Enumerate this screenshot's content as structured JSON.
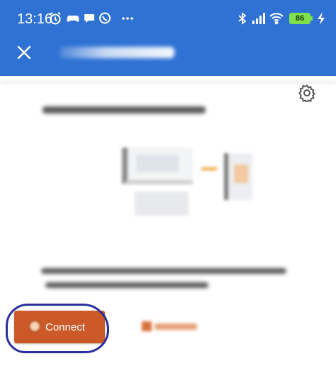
{
  "status_bar": {
    "time": "13:16",
    "battery_level": "86",
    "icons": [
      "alarm-icon",
      "controller-icon",
      "chat-bubble-icon",
      "viber-icon",
      "more-dots-icon",
      "bluetooth-icon",
      "signal-icon",
      "wifi-icon",
      "battery-icon",
      "charging-icon"
    ]
  },
  "app_bar": {
    "background_color": "#2f72d4",
    "close_icon": "close-icon"
  },
  "content": {
    "settings_icon": "gear-icon"
  },
  "actions": {
    "connect_label": "Connect",
    "connect_color": "#cc5a28",
    "annotation_color": "#2b2f9a"
  }
}
